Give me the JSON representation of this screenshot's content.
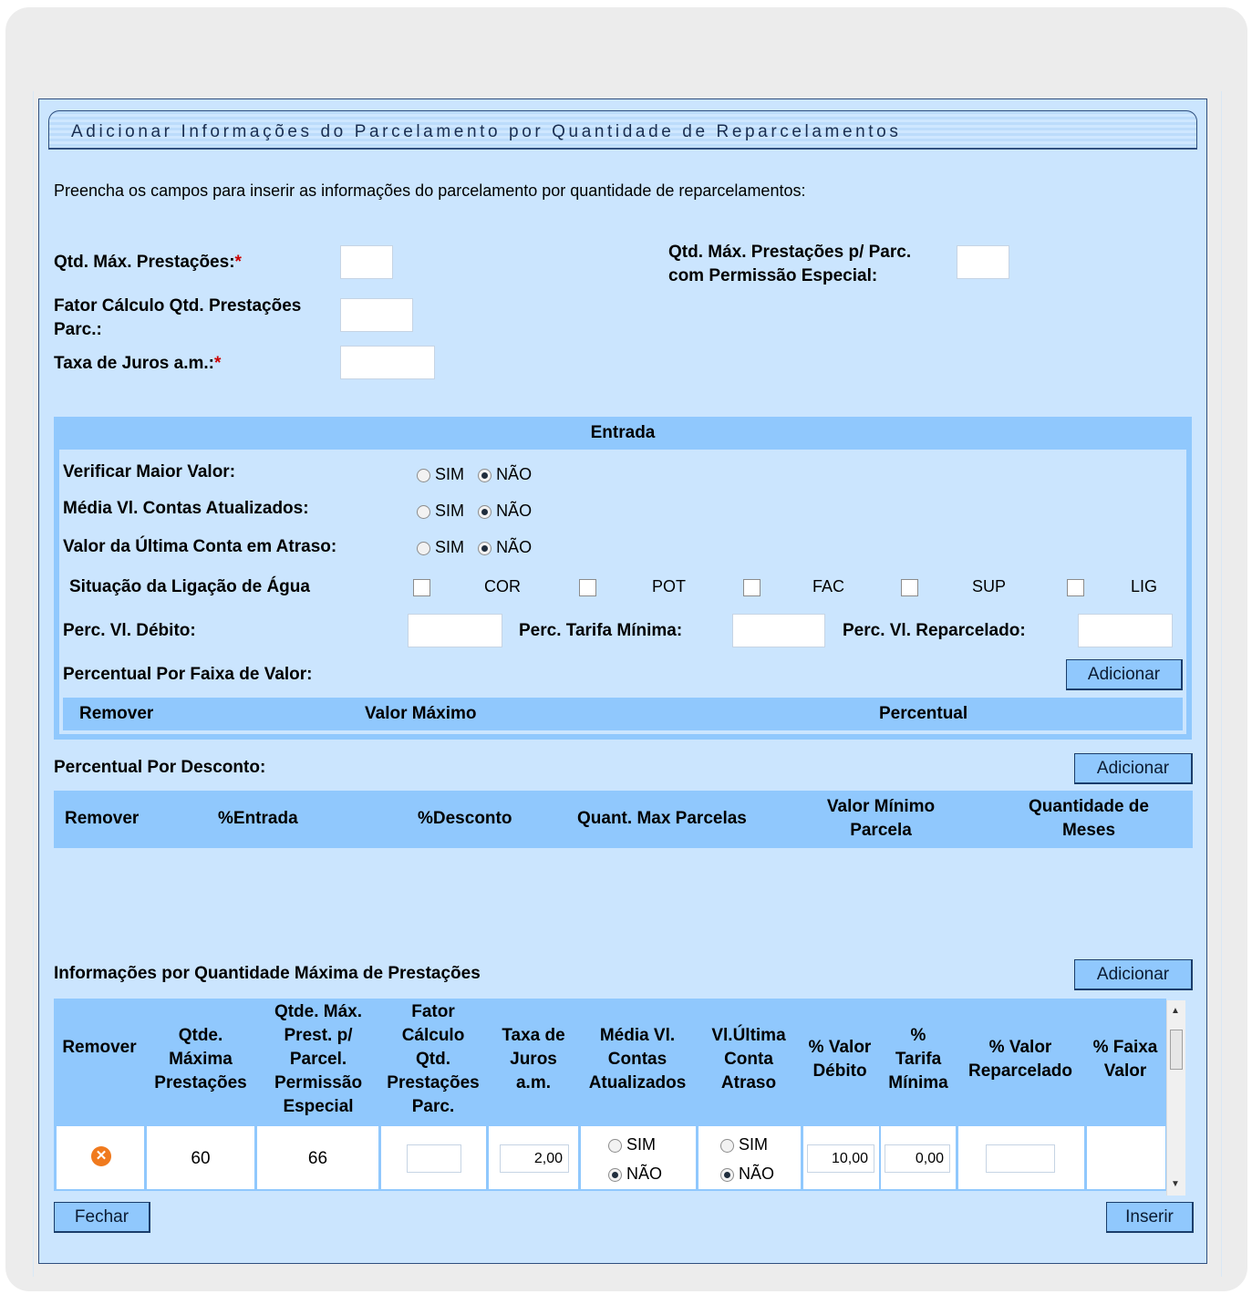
{
  "window": {
    "title": "Adicionar Informações do Parcelamento por Quantidade de Reparcelamentos",
    "instructions": "Preencha os campos para inserir as informações do parcelamento por quantidade de reparcelamentos:"
  },
  "form": {
    "qtd_max_prestacoes_label": "Qtd. Máx. Prestações:",
    "qtd_max_prestacoes_value": "",
    "qtd_max_perm_label_1": "Qtd. Máx. Prestações p/ Parc.",
    "qtd_max_perm_label_2": "com Permissão Especial:",
    "qtd_max_perm_value": "",
    "fator_label_1": "Fator Cálculo Qtd. Prestações",
    "fator_label_2": "Parc.:",
    "fator_value": "",
    "taxa_label": "Taxa de Juros a.m.:",
    "taxa_value": "",
    "required_mark": "*"
  },
  "entrada": {
    "title": "Entrada",
    "verificar_label": "Verificar Maior Valor:",
    "media_label": "Média Vl. Contas Atualizados:",
    "ultima_label": "Valor da Última Conta em Atraso:",
    "sim": "SIM",
    "nao": "NÃO",
    "situacao_label": "Situação da Ligação de Água",
    "situacoes": [
      "COR",
      "POT",
      "FAC",
      "SUP",
      "LIG"
    ],
    "perc_debito_label": "Perc. Vl. Débito:",
    "perc_tarifa_label": "Perc. Tarifa Mínima:",
    "perc_reparc_label": "Perc. Vl. Reparcelado:",
    "faixa_label": "Percentual Por Faixa de Valor:",
    "adicionar": "Adicionar",
    "faixa_cols": [
      "Remover",
      "Valor Máximo",
      "Percentual"
    ]
  },
  "desconto": {
    "label": "Percentual Por Desconto:",
    "adicionar": "Adicionar",
    "cols": [
      "Remover",
      "%Entrada",
      "%Desconto",
      "Quant. Max Parcelas",
      "Valor Mínimo\nParcela",
      "Quantidade de\nMeses"
    ]
  },
  "prestacoes": {
    "label": "Informações por Quantidade Máxima de Prestações",
    "adicionar": "Adicionar",
    "cols": [
      "Remover",
      "Qtde.\nMáxima\nPrestações",
      "Qtde. Máx.\nPrest. p/\nParcel.\nPermissão\nEspecial",
      "Fator\nCálculo\nQtd.\nPrestações\nParc.",
      "Taxa de\nJuros\na.m.",
      "Média Vl.\nContas\nAtualizados",
      "Vl.Última\nConta\nAtraso",
      "% Valor\nDébito",
      "%\nTarifa\nMínima",
      "% Valor\nReparcelado",
      "% Faixa\nValor"
    ],
    "row": {
      "qtd_max": "60",
      "qtd_perm": "66",
      "fator": "",
      "taxa": "2,00",
      "media_sim": "SIM",
      "media_nao": "NÃO",
      "ultima_sim": "SIM",
      "ultima_nao": "NÃO",
      "perc_debito": "10,00",
      "perc_tarifa": "0,00",
      "perc_reparc": ""
    }
  },
  "footer": {
    "fechar": "Fechar",
    "inserir": "Inserir"
  },
  "colors": {
    "panel_bg": "#cbe5fe",
    "header_bg": "#90c8fd",
    "border": "#2f4f7f",
    "remove_icon": "#f07a1e"
  }
}
